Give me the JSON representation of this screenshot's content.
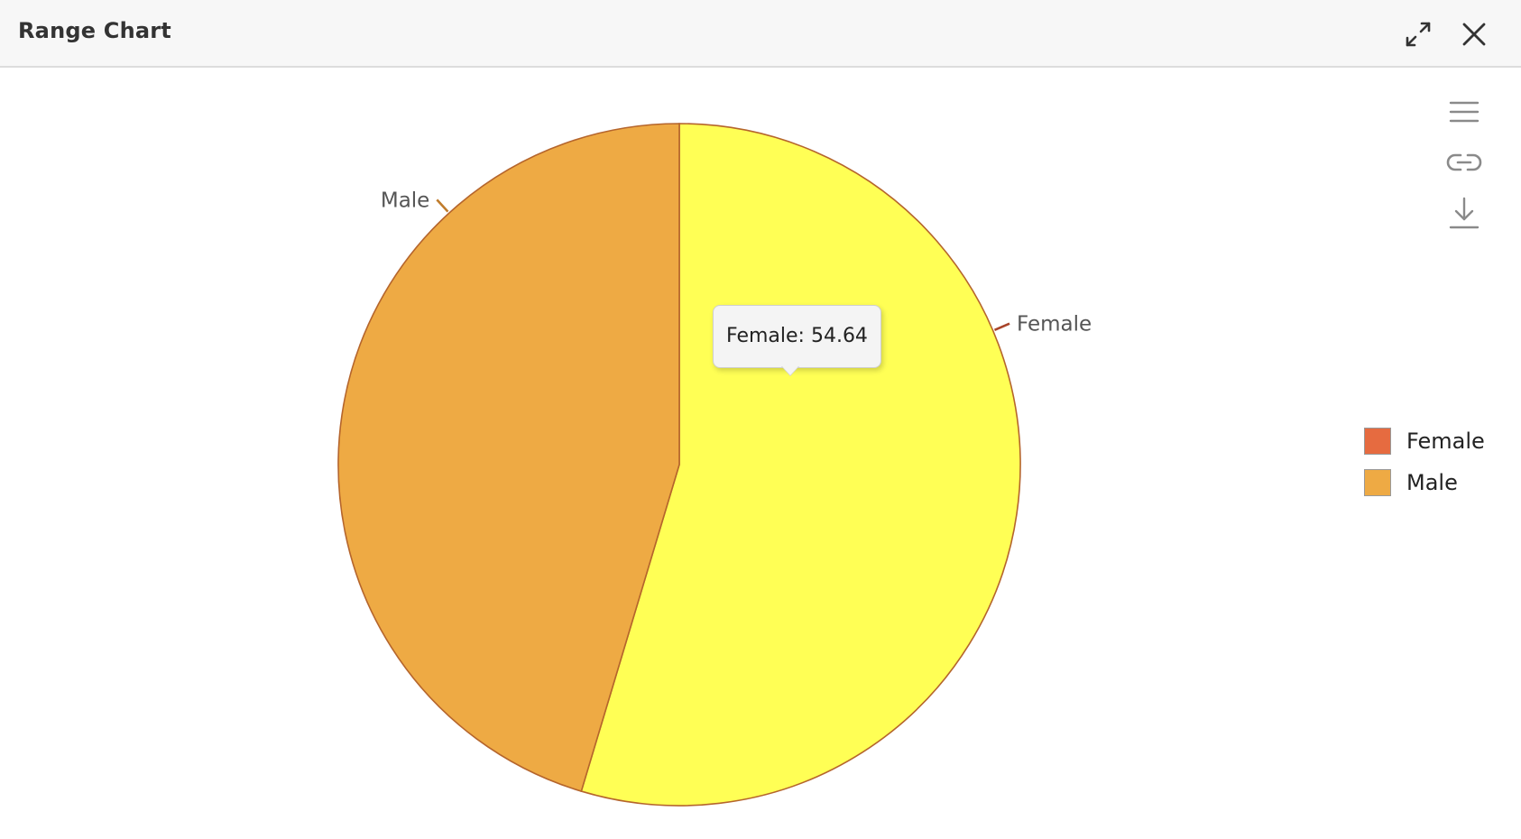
{
  "header": {
    "title": "Range Chart",
    "expand_icon": "expand-icon",
    "close_icon": "close-icon"
  },
  "toolbar": {
    "icons": [
      "menu-icon",
      "link-icon",
      "download-icon"
    ]
  },
  "tooltip": {
    "text": "Female: 54.64"
  },
  "colors": {
    "female_slice": "#ffff55",
    "male_slice": "#eeaa44",
    "female_legend": "#e66b40",
    "male_legend": "#eeaa44",
    "slice_border": "#b5652c",
    "female_connector": "#a8442a",
    "male_connector": "#c07c2c"
  },
  "legend": {
    "items": [
      {
        "label": "Female",
        "color": "#e66b40"
      },
      {
        "label": "Male",
        "color": "#eeaa44"
      }
    ]
  },
  "chart_data": {
    "type": "pie",
    "title": "Range Chart",
    "slices": [
      {
        "label": "Female",
        "value": 54.64,
        "color": "#ffff55"
      },
      {
        "label": "Male",
        "value": 45.36,
        "color": "#eeaa44"
      }
    ],
    "legend_position": "right",
    "start_angle": "top",
    "direction": "clockwise"
  }
}
